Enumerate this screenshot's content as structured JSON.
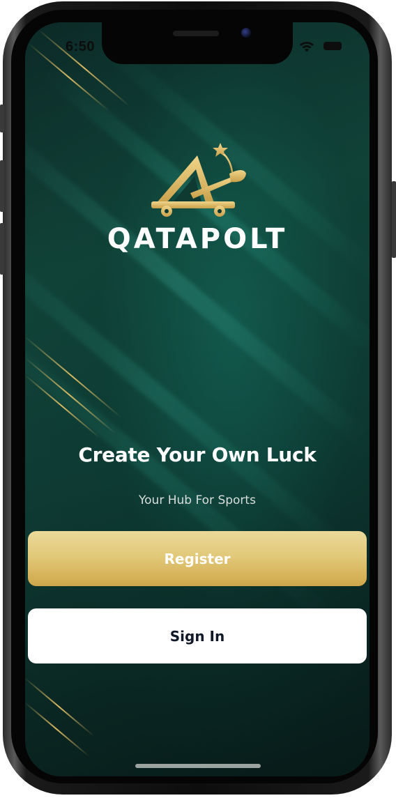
{
  "status_bar": {
    "time": "6:50",
    "wifi_icon": "wifi-icon",
    "battery_icon": "battery-icon"
  },
  "brand": {
    "name": "QATAPOLT",
    "logo_icon": "catapult-star-icon",
    "logo_color": "#d4ae55"
  },
  "hero": {
    "headline": "Create Your Own Luck",
    "subheadline": "Your Hub For Sports"
  },
  "actions": {
    "register_label": "Register",
    "signin_label": "Sign In"
  },
  "colors": {
    "background": "#0f2a25",
    "accent_gold": "#d4ae55",
    "signin_background": "#ffffff",
    "signin_text": "#111827"
  }
}
